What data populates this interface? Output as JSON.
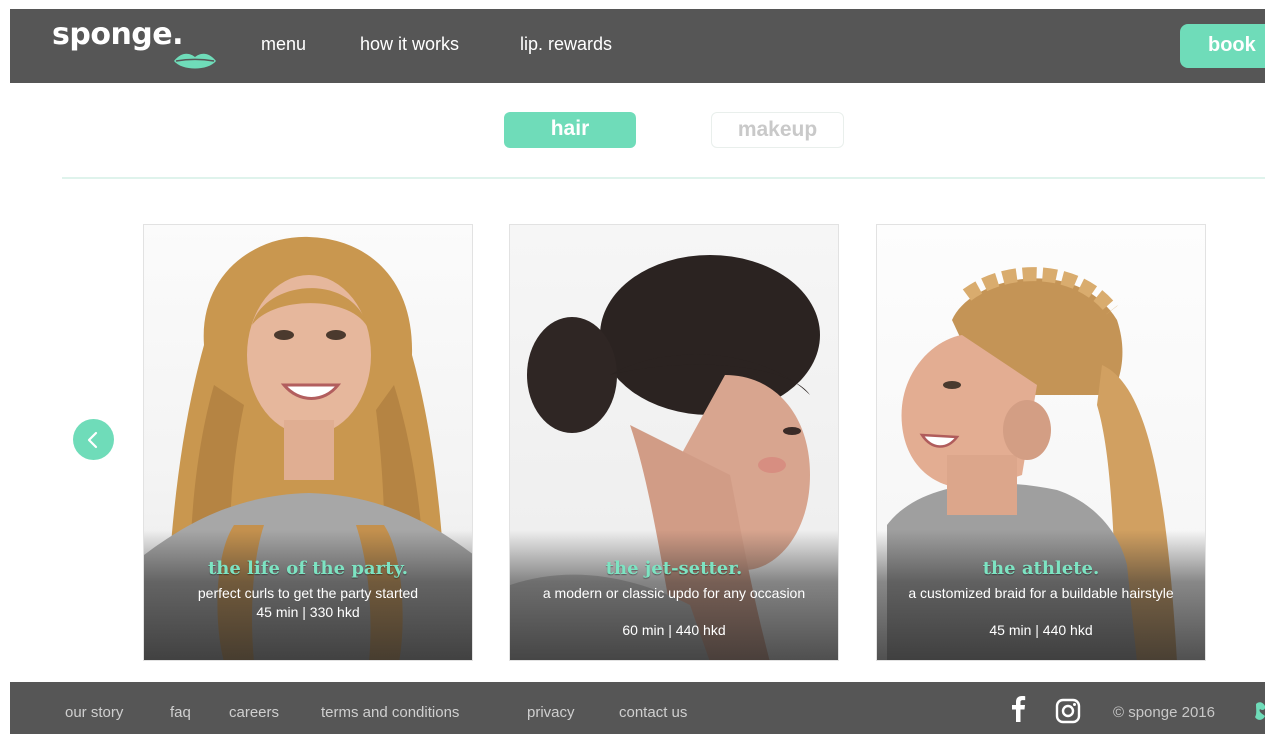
{
  "header": {
    "logo_text": "sponge.",
    "nav": [
      "menu",
      "how it works",
      "lip. rewards"
    ],
    "book_label": "book"
  },
  "tabs": {
    "hair": "hair",
    "makeup": "makeup",
    "active": "hair"
  },
  "cards": [
    {
      "title": "the life of the party.",
      "description": "perfect curls to get the party started",
      "price": "45 min | 330 hkd"
    },
    {
      "title": "the jet-setter.",
      "description": "a modern or classic updo for any occasion",
      "price": "60 min | 440 hkd"
    },
    {
      "title": "the athlete.",
      "description": "a customized braid for a buildable hairstyle",
      "price": "45 min | 440 hkd"
    }
  ],
  "footer": {
    "links": [
      "our story",
      "faq",
      "careers",
      "terms and conditions",
      "privacy",
      "contact us"
    ],
    "copyright": "© sponge 2016",
    "social": [
      "facebook-icon",
      "instagram-icon"
    ]
  },
  "colors": {
    "accent": "#6fdcb9",
    "header_bg": "#565656",
    "title_green": "#7de3c2"
  }
}
